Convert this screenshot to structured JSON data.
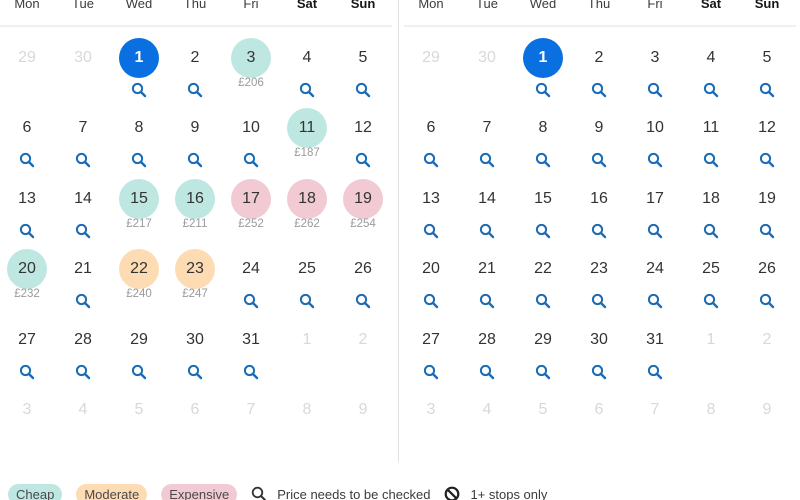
{
  "weekdays": [
    {
      "label": "Mon",
      "bold": false
    },
    {
      "label": "Tue",
      "bold": false
    },
    {
      "label": "Wed",
      "bold": false
    },
    {
      "label": "Thu",
      "bold": false
    },
    {
      "label": "Fri",
      "bold": false
    },
    {
      "label": "Sat",
      "bold": true
    },
    {
      "label": "Sun",
      "bold": true
    }
  ],
  "colors": {
    "cheap": "#bfe7e2",
    "moderate": "#fddcb3",
    "expensive": "#f2cad3",
    "selected": "#0a6fe0",
    "search_icon": "#1b6bb5"
  },
  "months": [
    {
      "id": "left",
      "days": [
        {
          "d": "29",
          "state": "muted"
        },
        {
          "d": "30",
          "state": "muted"
        },
        {
          "d": "1",
          "state": "selected",
          "search": true
        },
        {
          "d": "2",
          "search": true
        },
        {
          "d": "3",
          "state": "cheap",
          "price": "£206"
        },
        {
          "d": "4",
          "search": true
        },
        {
          "d": "5",
          "search": true
        },
        {
          "d": "6",
          "search": true
        },
        {
          "d": "7",
          "search": true
        },
        {
          "d": "8",
          "search": true
        },
        {
          "d": "9",
          "search": true
        },
        {
          "d": "10",
          "search": true
        },
        {
          "d": "11",
          "state": "cheap",
          "price": "£187"
        },
        {
          "d": "12",
          "search": true
        },
        {
          "d": "13",
          "search": true
        },
        {
          "d": "14",
          "search": true
        },
        {
          "d": "15",
          "state": "cheap",
          "price": "£217"
        },
        {
          "d": "16",
          "state": "cheap",
          "price": "£211"
        },
        {
          "d": "17",
          "state": "expensive",
          "price": "£252"
        },
        {
          "d": "18",
          "state": "expensive",
          "price": "£262"
        },
        {
          "d": "19",
          "state": "expensive",
          "price": "£254"
        },
        {
          "d": "20",
          "state": "cheap",
          "price": "£232"
        },
        {
          "d": "21",
          "search": true
        },
        {
          "d": "22",
          "state": "moderate",
          "price": "£240"
        },
        {
          "d": "23",
          "state": "moderate",
          "price": "£247"
        },
        {
          "d": "24",
          "search": true
        },
        {
          "d": "25",
          "search": true
        },
        {
          "d": "26",
          "search": true
        },
        {
          "d": "27",
          "search": true
        },
        {
          "d": "28",
          "search": true
        },
        {
          "d": "29",
          "search": true
        },
        {
          "d": "30",
          "search": true
        },
        {
          "d": "31",
          "search": true
        },
        {
          "d": "1",
          "state": "muted"
        },
        {
          "d": "2",
          "state": "muted"
        },
        {
          "d": "3",
          "state": "muted"
        },
        {
          "d": "4",
          "state": "muted"
        },
        {
          "d": "5",
          "state": "muted"
        },
        {
          "d": "6",
          "state": "muted"
        },
        {
          "d": "7",
          "state": "muted"
        },
        {
          "d": "8",
          "state": "muted"
        },
        {
          "d": "9",
          "state": "muted"
        }
      ]
    },
    {
      "id": "right",
      "days": [
        {
          "d": "29",
          "state": "muted"
        },
        {
          "d": "30",
          "state": "muted"
        },
        {
          "d": "1",
          "state": "selected",
          "search": true
        },
        {
          "d": "2",
          "search": true
        },
        {
          "d": "3",
          "search": true
        },
        {
          "d": "4",
          "search": true
        },
        {
          "d": "5",
          "search": true
        },
        {
          "d": "6",
          "search": true
        },
        {
          "d": "7",
          "search": true
        },
        {
          "d": "8",
          "search": true
        },
        {
          "d": "9",
          "search": true
        },
        {
          "d": "10",
          "search": true
        },
        {
          "d": "11",
          "search": true
        },
        {
          "d": "12",
          "search": true
        },
        {
          "d": "13",
          "search": true
        },
        {
          "d": "14",
          "search": true
        },
        {
          "d": "15",
          "search": true
        },
        {
          "d": "16",
          "search": true
        },
        {
          "d": "17",
          "search": true
        },
        {
          "d": "18",
          "search": true
        },
        {
          "d": "19",
          "search": true
        },
        {
          "d": "20",
          "search": true
        },
        {
          "d": "21",
          "search": true
        },
        {
          "d": "22",
          "search": true
        },
        {
          "d": "23",
          "search": true
        },
        {
          "d": "24",
          "search": true
        },
        {
          "d": "25",
          "search": true
        },
        {
          "d": "26",
          "search": true
        },
        {
          "d": "27",
          "search": true
        },
        {
          "d": "28",
          "search": true
        },
        {
          "d": "29",
          "search": true
        },
        {
          "d": "30",
          "search": true
        },
        {
          "d": "31",
          "search": true
        },
        {
          "d": "1",
          "state": "muted"
        },
        {
          "d": "2",
          "state": "muted"
        },
        {
          "d": "3",
          "state": "muted"
        },
        {
          "d": "4",
          "state": "muted"
        },
        {
          "d": "5",
          "state": "muted"
        },
        {
          "d": "6",
          "state": "muted"
        },
        {
          "d": "7",
          "state": "muted"
        },
        {
          "d": "8",
          "state": "muted"
        },
        {
          "d": "9",
          "state": "muted"
        }
      ]
    }
  ],
  "legend": {
    "cheap": "Cheap",
    "moderate": "Moderate",
    "expensive": "Expensive",
    "check_price": "Price needs to be checked",
    "stops": "1+ stops only"
  }
}
